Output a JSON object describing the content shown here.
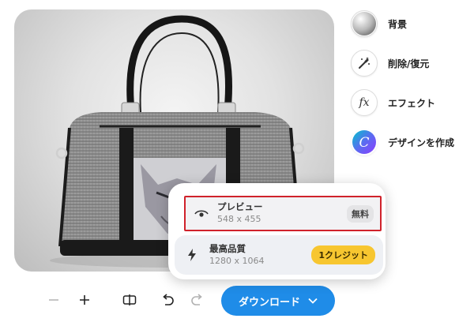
{
  "tools": [
    {
      "id": "background",
      "label": "背景",
      "icon": "gradient-sphere-icon"
    },
    {
      "id": "erase-restore",
      "label": "削除/復元",
      "icon": "magic-brush-icon"
    },
    {
      "id": "effects",
      "label": "エフェクト",
      "icon": "fx-icon"
    },
    {
      "id": "design",
      "label": "デザインを作成",
      "icon": "canva-logo-icon"
    }
  ],
  "toolbar": {
    "download_label": "ダウンロード",
    "zoom_out_icon": "minus-icon",
    "zoom_in_icon": "plus-icon",
    "compare_icon": "compare-split-icon",
    "undo_icon": "undo-icon",
    "redo_icon": "redo-icon"
  },
  "download_options": [
    {
      "name": "プレビュー",
      "size": "548 x 455",
      "badge": "無料",
      "icon": "eye-icon"
    },
    {
      "name": "最高品質",
      "size": "1280 x 1064",
      "badge": "1クレジット",
      "icon": "lightning-icon"
    }
  ],
  "colors": {
    "download_button": "#1f8ce8",
    "highlight_border": "#d0222b",
    "credit_badge": "#f7c630"
  },
  "canvas": {
    "subject": "gray felt handbag with husky patch"
  }
}
